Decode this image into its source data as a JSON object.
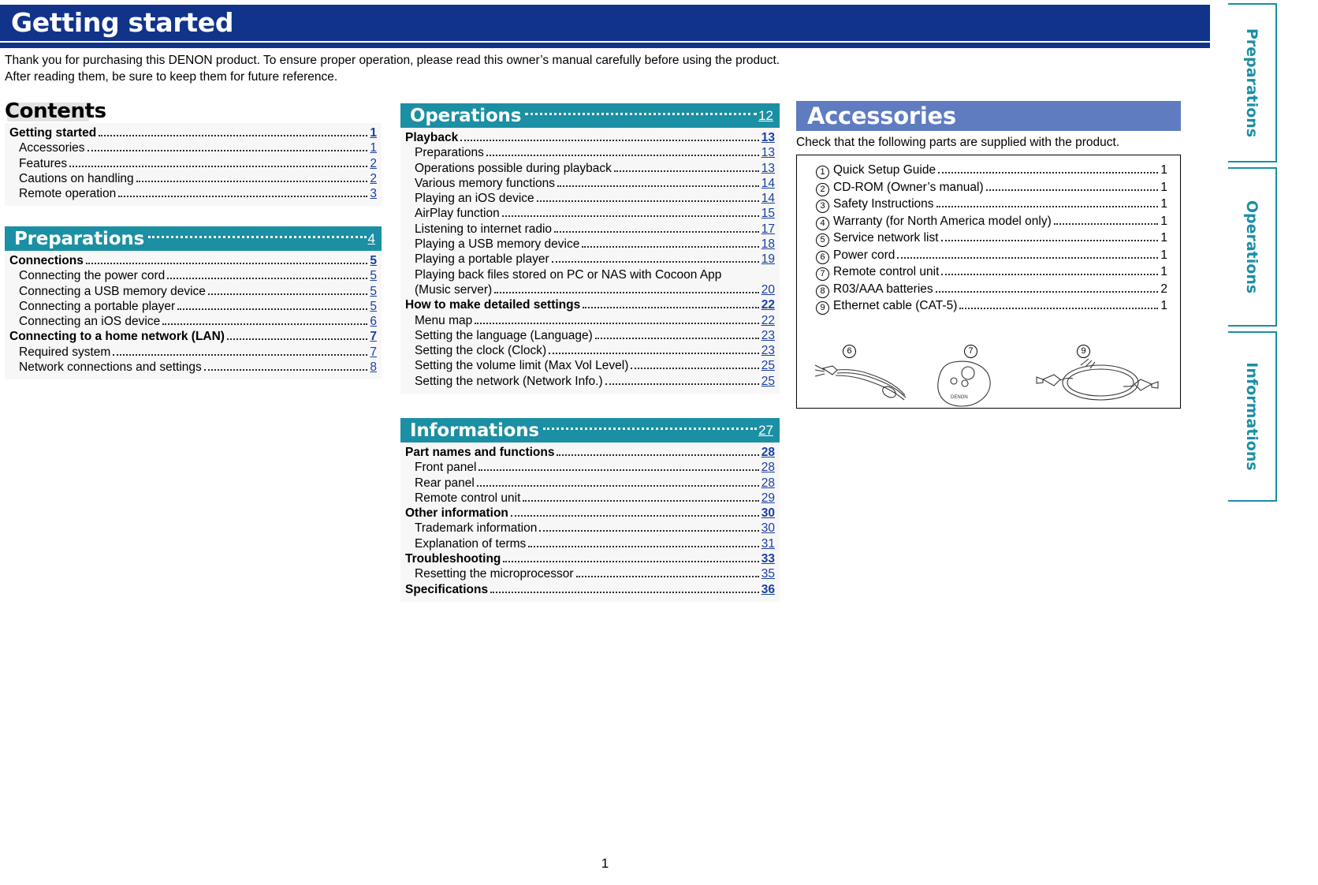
{
  "header": {
    "title": "Getting started",
    "intro_line1": "Thank you for purchasing this DENON product. To ensure proper operation, please read this owner’s manual carefully before using the product.",
    "intro_line2": "After reading them, be sure to keep them for future reference."
  },
  "contents_heading": "Contents",
  "colors": {
    "navy": "#11348a",
    "teal": "#1b8fa3",
    "periwinkle": "#5f7cc0",
    "link": "#1a3fa0",
    "panel_bg": "#f7f7f7"
  },
  "toc": {
    "getting_started": {
      "bar": null,
      "rows": [
        {
          "level": 1,
          "label": "Getting started",
          "page": "1"
        },
        {
          "level": 2,
          "label": "Accessories",
          "page": "1"
        },
        {
          "level": 2,
          "label": "Features",
          "page": "2"
        },
        {
          "level": 2,
          "label": "Cautions on handling",
          "page": "2"
        },
        {
          "level": 2,
          "label": "Remote operation",
          "page": "3"
        }
      ]
    },
    "preparations": {
      "bar": {
        "label": "Preparations",
        "page": "4",
        "color": "teal"
      },
      "rows": [
        {
          "level": 1,
          "label": "Connections",
          "page": "5"
        },
        {
          "level": 2,
          "label": "Connecting the power cord",
          "page": "5"
        },
        {
          "level": 2,
          "label": "Connecting a USB memory device",
          "page": "5"
        },
        {
          "level": 2,
          "label": "Connecting a portable player",
          "page": "5"
        },
        {
          "level": 2,
          "label": "Connecting an iOS device",
          "page": "6"
        },
        {
          "level": 1,
          "label": "Connecting to a home network (LAN)",
          "page": "7"
        },
        {
          "level": 2,
          "label": "Required system",
          "page": "7"
        },
        {
          "level": 2,
          "label": "Network connections and settings",
          "page": "8"
        }
      ]
    },
    "operations": {
      "bar": {
        "label": "Operations",
        "page": "12",
        "color": "teal"
      },
      "rows": [
        {
          "level": 1,
          "label": "Playback",
          "page": "13"
        },
        {
          "level": 2,
          "label": "Preparations",
          "page": "13"
        },
        {
          "level": 2,
          "label": "Operations possible during playback",
          "page": "13"
        },
        {
          "level": 2,
          "label": "Various memory functions",
          "page": "14"
        },
        {
          "level": 2,
          "label": "Playing an iOS device",
          "page": "14"
        },
        {
          "level": 2,
          "label": "AirPlay function",
          "page": "15"
        },
        {
          "level": 2,
          "label": "Listening to internet radio",
          "page": "17"
        },
        {
          "level": 2,
          "label": "Playing a USB memory device",
          "page": "18"
        },
        {
          "level": 2,
          "label": "Playing a portable player",
          "page": "19"
        },
        {
          "level": 2,
          "label": "Playing back files stored on PC or NAS with Cocoon App",
          "page": "",
          "noleader": true
        },
        {
          "level": 2,
          "label": "(Music server)",
          "page": "20"
        },
        {
          "level": 1,
          "label": "How to make detailed settings",
          "page": "22"
        },
        {
          "level": 2,
          "label": "Menu map",
          "page": "22"
        },
        {
          "level": 2,
          "label": "Setting the language (Language)",
          "page": "23"
        },
        {
          "level": 2,
          "label": "Setting the clock (Clock)",
          "page": "23"
        },
        {
          "level": 2,
          "label": "Setting the volume limit (Max Vol Level)",
          "page": "25"
        },
        {
          "level": 2,
          "label": "Setting the network (Network Info.)",
          "page": "25"
        }
      ]
    },
    "informations": {
      "bar": {
        "label": "Informations",
        "page": "27",
        "color": "teal"
      },
      "rows": [
        {
          "level": 1,
          "label": "Part names and functions",
          "page": "28"
        },
        {
          "level": 2,
          "label": "Front panel",
          "page": "28"
        },
        {
          "level": 2,
          "label": "Rear panel",
          "page": "28"
        },
        {
          "level": 2,
          "label": "Remote control unit",
          "page": "29"
        },
        {
          "level": 1,
          "label": "Other information",
          "page": "30"
        },
        {
          "level": 2,
          "label": "Trademark information",
          "page": "30"
        },
        {
          "level": 2,
          "label": "Explanation of terms",
          "page": "31"
        },
        {
          "level": 1,
          "label": "Troubleshooting",
          "page": "33"
        },
        {
          "level": 2,
          "label": "Resetting the microprocessor",
          "page": "35"
        },
        {
          "level": 1,
          "label": "Specifications",
          "page": "36"
        }
      ]
    }
  },
  "accessories": {
    "title": "Accessories",
    "check_text": "Check that the following parts are supplied with the product.",
    "items": [
      {
        "num": "1",
        "label": "Quick Setup Guide",
        "qty": "1"
      },
      {
        "num": "2",
        "label": "CD-ROM (Owner’s manual)",
        "qty": "1"
      },
      {
        "num": "3",
        "label": "Safety Instructions",
        "qty": "1"
      },
      {
        "num": "4",
        "label": "Warranty (for North America model only)",
        "qty": "1"
      },
      {
        "num": "5",
        "label": "Service network list",
        "qty": "1"
      },
      {
        "num": "6",
        "label": "Power cord",
        "qty": "1"
      },
      {
        "num": "7",
        "label": "Remote control unit",
        "qty": "1"
      },
      {
        "num": "8",
        "label": "R03/AAA batteries",
        "qty": "2"
      },
      {
        "num": "9",
        "label": "Ethernet cable (CAT-5)",
        "qty": "1"
      }
    ],
    "illustration_captions": [
      "6",
      "7",
      "9"
    ]
  },
  "side_tabs": [
    {
      "label": "Preparations"
    },
    {
      "label": "Operations"
    },
    {
      "label": "Informations"
    }
  ],
  "folio": "1"
}
